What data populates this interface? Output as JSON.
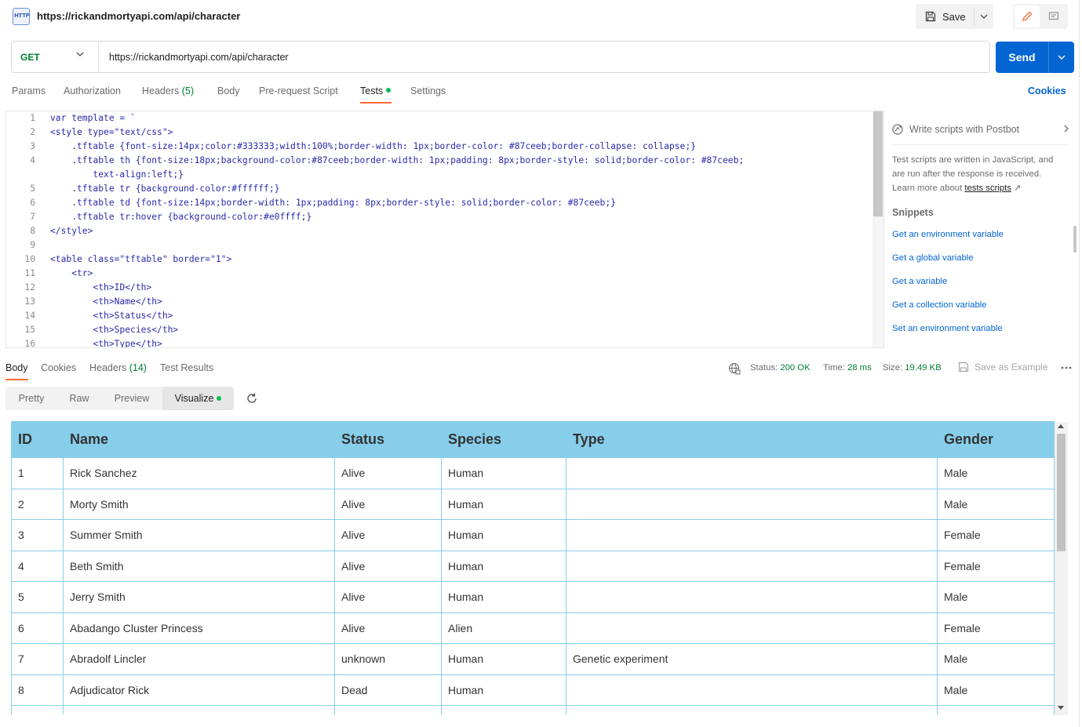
{
  "title": {
    "text": "https://rickandmortyapi.com/api/character",
    "icon_label": "HTTP",
    "save_label": "Save"
  },
  "request": {
    "method": "GET",
    "url": "https://rickandmortyapi.com/api/character",
    "send_label": "Send"
  },
  "req_tabs": {
    "params": "Params",
    "authorization": "Authorization",
    "headers": "Headers",
    "headers_count": "(5)",
    "body": "Body",
    "pre_request": "Pre-request Script",
    "tests": "Tests",
    "settings": "Settings",
    "cookies": "Cookies"
  },
  "editor": {
    "lines": [
      {
        "n": "1",
        "text": "var template = `"
      },
      {
        "n": "2",
        "text": "<style type=\"text/css\">"
      },
      {
        "n": "3",
        "text": "    .tftable {font-size:14px;color:#333333;width:100%;border-width: 1px;border-color: #87ceeb;border-collapse: collapse;}"
      },
      {
        "n": "4",
        "text": "    .tftable th {font-size:18px;background-color:#87ceeb;border-width: 1px;padding: 8px;border-style: solid;border-color: #87ceeb;"
      },
      {
        "n": "",
        "text": "        text-align:left;}"
      },
      {
        "n": "5",
        "text": "    .tftable tr {background-color:#ffffff;}"
      },
      {
        "n": "6",
        "text": "    .tftable td {font-size:14px;border-width: 1px;padding: 8px;border-style: solid;border-color: #87ceeb;}"
      },
      {
        "n": "7",
        "text": "    .tftable tr:hover {background-color:#e0ffff;}"
      },
      {
        "n": "8",
        "text": "</style>"
      },
      {
        "n": "9",
        "text": ""
      },
      {
        "n": "10",
        "text": "<table class=\"tftable\" border=\"1\">"
      },
      {
        "n": "11",
        "text": "    <tr>"
      },
      {
        "n": "12",
        "text": "        <th>ID</th>"
      },
      {
        "n": "13",
        "text": "        <th>Name</th>"
      },
      {
        "n": "14",
        "text": "        <th>Status</th>"
      },
      {
        "n": "15",
        "text": "        <th>Species</th>"
      },
      {
        "n": "16",
        "text": "        <th>Type</th>"
      }
    ]
  },
  "sidebar": {
    "postbot": "Write scripts with Postbot",
    "desc_part1": "Test scripts are written in JavaScript, and are run after the response is received. Learn more about ",
    "desc_link": "tests scripts",
    "desc_arrow": "↗",
    "snippets_title": "Snippets",
    "snippets": [
      "Get an environment variable",
      "Get a global variable",
      "Get a variable",
      "Get a collection variable",
      "Set an environment variable"
    ]
  },
  "response": {
    "tabs": {
      "body": "Body",
      "cookies": "Cookies",
      "headers": "Headers",
      "headers_count": "(14)",
      "test_results": "Test Results"
    },
    "status_label": "Status:",
    "status_value": "200 OK",
    "time_label": "Time:",
    "time_value": "28 ms",
    "size_label": "Size:",
    "size_value": "19.49 KB",
    "save_example": "Save as Example",
    "views": {
      "pretty": "Pretty",
      "raw": "Raw",
      "preview": "Preview",
      "visualize": "Visualize"
    }
  },
  "table": {
    "headers": [
      "ID",
      "Name",
      "Status",
      "Species",
      "Type",
      "Gender"
    ],
    "rows": [
      [
        "1",
        "Rick Sanchez",
        "Alive",
        "Human",
        "",
        "Male"
      ],
      [
        "2",
        "Morty Smith",
        "Alive",
        "Human",
        "",
        "Male"
      ],
      [
        "3",
        "Summer Smith",
        "Alive",
        "Human",
        "",
        "Female"
      ],
      [
        "4",
        "Beth Smith",
        "Alive",
        "Human",
        "",
        "Female"
      ],
      [
        "5",
        "Jerry Smith",
        "Alive",
        "Human",
        "",
        "Male"
      ],
      [
        "6",
        "Abadango Cluster Princess",
        "Alive",
        "Alien",
        "",
        "Female"
      ],
      [
        "7",
        "Abradolf Lincler",
        "unknown",
        "Human",
        "Genetic experiment",
        "Male"
      ],
      [
        "8",
        "Adjudicator Rick",
        "Dead",
        "Human",
        "",
        "Male"
      ],
      [
        "",
        "",
        "",
        "",
        "",
        ""
      ]
    ]
  },
  "colors": {
    "accent_orange": "#ff6c37",
    "send_blue": "#0265d2",
    "method_green": "#007f31",
    "table_header": "#87ceeb"
  }
}
